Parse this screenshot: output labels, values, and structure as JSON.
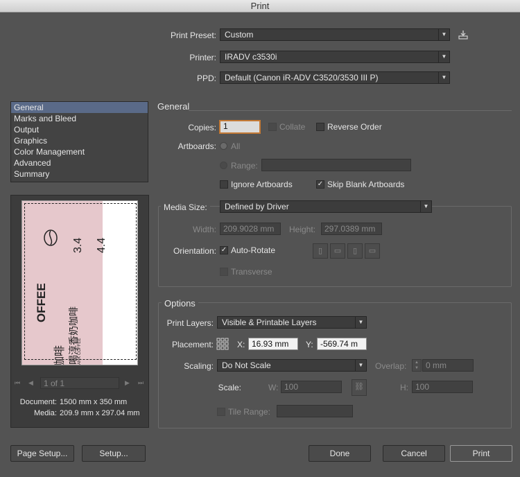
{
  "window": {
    "title": "Print"
  },
  "top": {
    "preset_label": "Print Preset:",
    "preset_value": "Custom",
    "printer_label": "Printer:",
    "printer_value": "IRADV c3530i",
    "ppd_label": "PPD:",
    "ppd_value": "Default (Canon iR-ADV C3520/3530 III P)"
  },
  "sidebar": {
    "items": [
      {
        "label": "General"
      },
      {
        "label": "Marks and Bleed"
      },
      {
        "label": "Output"
      },
      {
        "label": "Graphics"
      },
      {
        "label": "Color Management"
      },
      {
        "label": "Advanced"
      },
      {
        "label": "Summary"
      }
    ],
    "selected": "General"
  },
  "preview": {
    "text_coffee": "OFFEE",
    "text_cn1": "咖啡",
    "text_cn2": "喝淳香奶咖啡",
    "text_small": "ANK COFFEE",
    "text_num1": "3.4",
    "text_num2": "4.4",
    "page_indicator": "1 of 1",
    "document_label": "Document:",
    "document_value": "1500 mm x 350 mm",
    "media_label": "Media:",
    "media_value": "209.9 mm x 297.04 mm",
    "colors": {
      "pink": "#e6c8cc",
      "paper": "#ffffff"
    }
  },
  "general": {
    "title": "General",
    "copies_label": "Copies:",
    "copies_value": "1",
    "collate_label": "Collate",
    "reverse_label": "Reverse Order",
    "artboards_label": "Artboards:",
    "all_label": "All",
    "range_label": "Range:",
    "ignore_artboards_label": "Ignore Artboards",
    "skip_blank_label": "Skip Blank Artboards",
    "skip_blank_checked": true
  },
  "media": {
    "size_label": "Media Size:",
    "size_value": "Defined by Driver",
    "width_label": "Width:",
    "width_value": "209.9028 mm",
    "height_label": "Height:",
    "height_value": "297.0389 mm",
    "orientation_label": "Orientation:",
    "auto_rotate_label": "Auto-Rotate",
    "auto_rotate_checked": true,
    "transverse_label": "Transverse"
  },
  "options": {
    "title": "Options",
    "layers_label": "Print Layers:",
    "layers_value": "Visible & Printable Layers",
    "placement_label": "Placement:",
    "x_label": "X:",
    "x_value": "16.93 mm",
    "y_label": "Y:",
    "y_value": "-569.74 m",
    "scaling_label": "Scaling:",
    "scaling_value": "Do Not Scale",
    "overlap_label": "Overlap:",
    "overlap_value": "0 mm",
    "scale_label": "Scale:",
    "w_label": "W:",
    "w_value": "100",
    "h_label": "H:",
    "h_value": "100",
    "tile_label": "Tile Range:"
  },
  "buttons": {
    "page_setup": "Page Setup...",
    "setup": "Setup...",
    "done": "Done",
    "cancel": "Cancel",
    "print": "Print"
  }
}
